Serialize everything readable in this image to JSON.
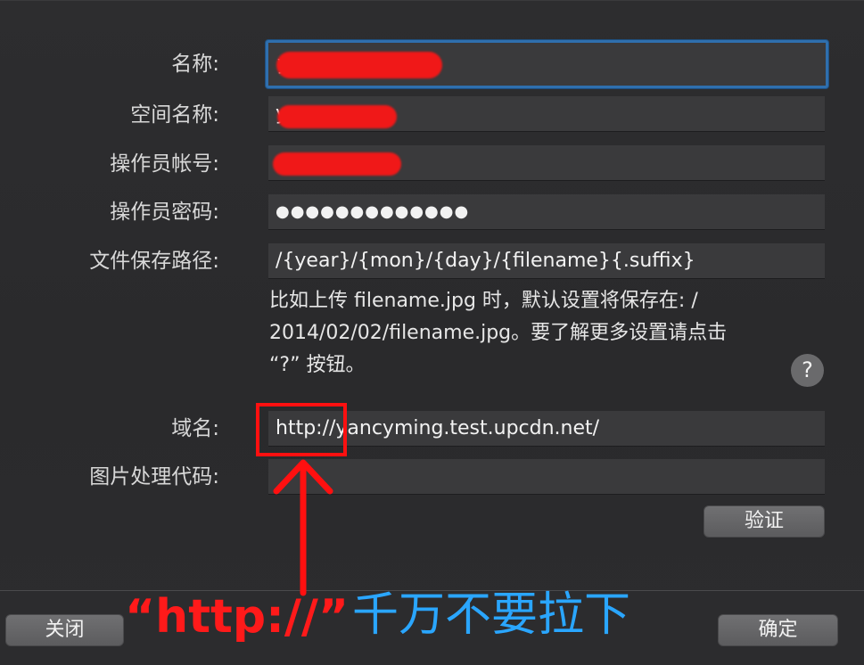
{
  "form": {
    "name_label": "名称:",
    "name_value": "y",
    "space_label": "空间名称:",
    "space_value": "y",
    "operator_label": "操作员帐号:",
    "operator_value": "",
    "password_label": "操作员密码:",
    "password_value": "●●●●●●●●●●●●●",
    "path_label": "文件保存路径:",
    "path_value": "/{year}/{mon}/{day}/{filename}{.suffix}",
    "hint_lines": [
      "比如上传 filename.jpg 时，默认设置将保存在: /",
      "2014/02/02/filename.jpg。要了解更多设置请点击",
      "“?” 按钮。"
    ],
    "help_label": "?",
    "domain_label": "域名:",
    "domain_value": "http://yancyming.test.upcdn.net/",
    "image_code_label": "图片处理代码:",
    "image_code_value": "",
    "verify_label": "验证"
  },
  "footer": {
    "close_label": "关闭",
    "ok_label": "确定"
  },
  "annotation": {
    "red_text": "“http://”",
    "blue_text": "千万不要拉下"
  },
  "colors": {
    "background": "#2a2a2c",
    "field": "#3a3a3c",
    "focus_ring": "#2f6fae",
    "annotation_red": "#ff1a1a",
    "annotation_blue": "#2aa6ff"
  }
}
